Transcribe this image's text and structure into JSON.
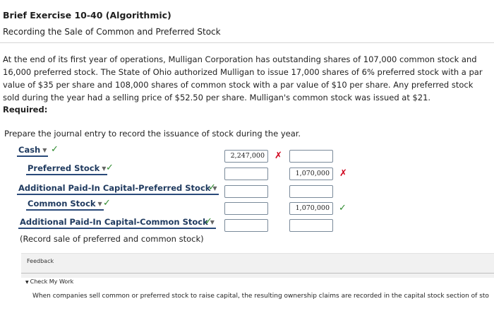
{
  "header": {
    "title": "Brief Exercise 10-40 (Algorithmic)",
    "subtitle": "Recording the Sale of Common and Preferred Stock"
  },
  "problem": {
    "text": "At the end of its first year of operations, Mulligan Corporation has outstanding shares of 107,000 common stock and 16,000 preferred stock. The State of Ohio authorized Mulligan to issue 17,000 shares of 6% preferred stock with a par value of $35 per share and 108,000 shares of common stock with a par value of $10 per share. Any preferred stock sold during the year had a selling price of $52.50 per share. Mulligan's common stock was issued at $21."
  },
  "required": {
    "label": "Required:",
    "prompt": "Prepare the journal entry to record the issuance of stock during the year."
  },
  "journal": {
    "rows": [
      {
        "account": "Cash",
        "debit": "2,247,000",
        "credit": ""
      },
      {
        "account": "Preferred Stock",
        "debit": "",
        "credit": "1,070,000"
      },
      {
        "account": "Additional Paid-In Capital-Preferred Stock",
        "debit": "",
        "credit": ""
      },
      {
        "account": "Common Stock",
        "debit": "",
        "credit": "1,070,000"
      },
      {
        "account": "Additional Paid-In Capital-Common Stock",
        "debit": "",
        "credit": ""
      }
    ],
    "note": "(Record sale of preferred and common stock)"
  },
  "feedback": {
    "label": "Feedback",
    "check_label": "Check My Work",
    "text": "When companies sell common or preferred stock to raise capital, the resulting ownership claims are recorded in the capital stock section of sto"
  },
  "icons": {
    "dropdown": "chevron-down-icon",
    "correct": "checkmark-icon",
    "incorrect": "x-mark-icon",
    "expand": "triangle-down-icon"
  },
  "colors": {
    "correct": "#2e8b2e",
    "incorrect": "#d0021b",
    "account_text": "#1f3a5f"
  }
}
